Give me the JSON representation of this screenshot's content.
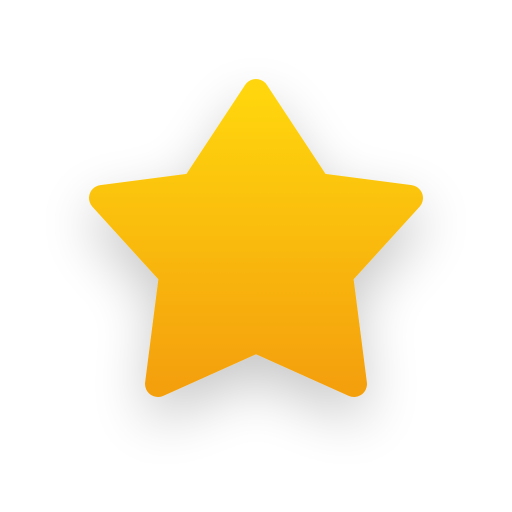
{
  "icon": {
    "name": "star-icon",
    "colors": {
      "gradient_top": "#FFD60F",
      "gradient_bottom": "#F4A00A",
      "background": "#FFFFFF",
      "shadow": "#000000"
    }
  }
}
